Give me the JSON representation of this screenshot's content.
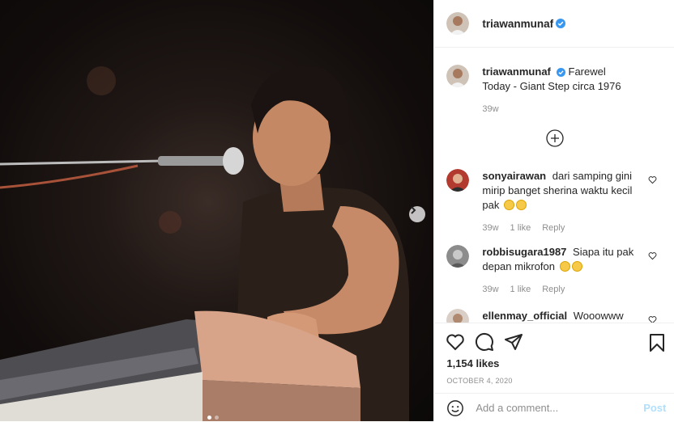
{
  "post": {
    "username": "triawanmunaf",
    "caption": "Farewel Today - Giant Step circa 1976",
    "caption_time": "39w",
    "likes": "1,154 likes",
    "date": "OCTOBER 4, 2020"
  },
  "comments": [
    {
      "username": "sonyairawan",
      "text": "dari samping gini mirip banget sherina waktu kecil pak",
      "emoji": "😀😀",
      "time": "39w",
      "likes": "1 like",
      "reply": "Reply"
    },
    {
      "username": "robbisugara1987",
      "text": "Siapa itu pak depan mikrofon",
      "emoji": "🤔🤔",
      "time": "39w",
      "likes": "1 like",
      "reply": "Reply"
    },
    {
      "username": "ellenmay_official",
      "text": "Wooowww"
    }
  ],
  "add_comment": {
    "placeholder": "Add a comment...",
    "post_label": "Post"
  },
  "carousel": {
    "total": 2,
    "active": 0
  },
  "colors": {
    "verified": "#3897f0",
    "post_button": "#b2dffc"
  }
}
